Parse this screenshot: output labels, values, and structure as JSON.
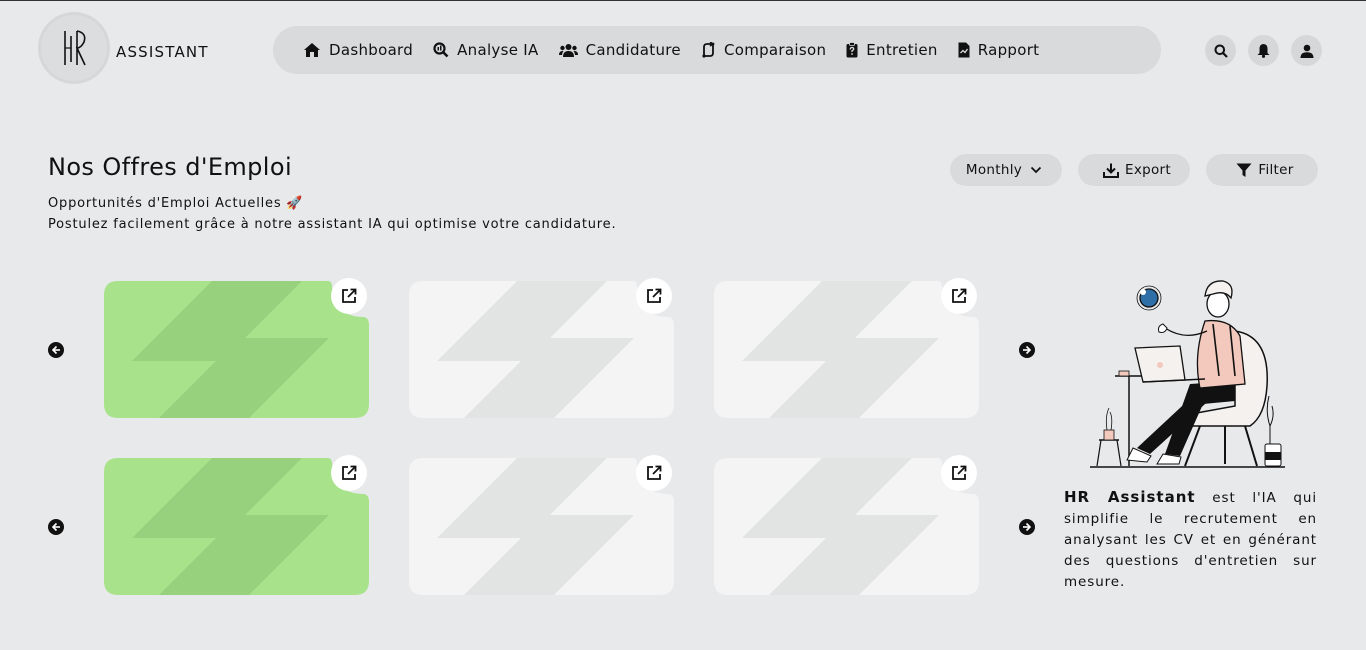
{
  "app": {
    "brand": "ASSISTANT",
    "logo_text": "HR"
  },
  "nav": {
    "items": [
      {
        "label": "Dashboard",
        "icon": "home-icon"
      },
      {
        "label": "Analyse IA",
        "icon": "magnifier-chart-icon"
      },
      {
        "label": "Candidature",
        "icon": "users-icon"
      },
      {
        "label": "Comparaison",
        "icon": "compare-arrows-icon"
      },
      {
        "label": "Entretien",
        "icon": "clipboard-question-icon"
      },
      {
        "label": "Rapport",
        "icon": "file-chart-icon"
      }
    ]
  },
  "header_actions": [
    "search-icon",
    "bell-icon",
    "user-icon"
  ],
  "page": {
    "title": "Nos Offres d'Emploi",
    "subtitle_line1": "Opportunités d'Emploi Actuelles 🚀",
    "subtitle_line2": "Postulez facilement grâce à notre assistant IA qui optimise votre candidature."
  },
  "toolbar": {
    "period": "Monthly",
    "export_label": "Export",
    "filter_label": "Filter"
  },
  "cards": {
    "rows": [
      [
        {
          "variant": "green"
        },
        {
          "variant": "grey"
        },
        {
          "variant": "grey"
        }
      ],
      [
        {
          "variant": "green"
        },
        {
          "variant": "grey"
        },
        {
          "variant": "grey"
        }
      ]
    ]
  },
  "side_panel": {
    "brand_bold": "HR Assistant",
    "description": " est l'IA qui simplifie le recrutement en analysant les CV et en générant des questions d'entretien sur mesure."
  },
  "colors": {
    "background": "#e8e9eb",
    "nav_bg": "#d9dadc",
    "card_green": "#a8e38b",
    "card_green_accent": "#97d17e",
    "card_grey": "#f4f4f4",
    "card_grey_accent": "#e2e3e3"
  }
}
